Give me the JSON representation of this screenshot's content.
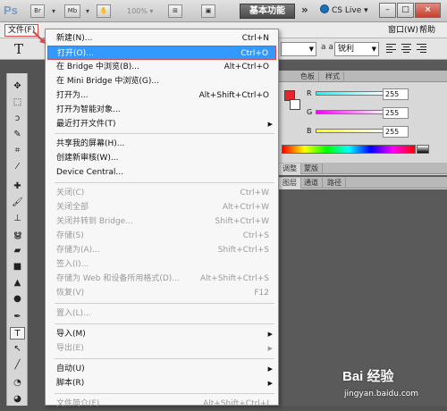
{
  "titlebar": {
    "logo": "Ps",
    "bridge": "Br",
    "minibridge": "Mb",
    "zoom": "100%",
    "workspace": "基本功能",
    "chevron": "»",
    "cslive": "CS Live",
    "minimize": "–",
    "restore": "□",
    "close": "×"
  },
  "menubar": {
    "items": [
      "文件(F)",
      "帮助(H)",
      "窗口(W)"
    ]
  },
  "options": {
    "tool_glyph": "T",
    "antialias_prefix": "a a",
    "antialias_value": "锐利"
  },
  "menu": {
    "items": [
      {
        "label": "新建(N)...",
        "shortcut": "Ctrl+N"
      },
      {
        "label": "打开(O)...",
        "shortcut": "Ctrl+O"
      },
      {
        "label": "在 Bridge 中浏览(B)...",
        "shortcut": "Alt+Ctrl+O"
      },
      {
        "label": "在 Mini Bridge 中浏览(G)...",
        "shortcut": ""
      },
      {
        "label": "打开为...",
        "shortcut": "Alt+Shift+Ctrl+O"
      },
      {
        "label": "打开为智能对象...",
        "shortcut": ""
      },
      {
        "label": "最近打开文件(T)",
        "shortcut": ""
      },
      {
        "label": "共享我的屏幕(H)...",
        "shortcut": ""
      },
      {
        "label": "创建新审核(W)...",
        "shortcut": ""
      },
      {
        "label": "Device Central...",
        "shortcut": ""
      },
      {
        "label": "关闭(C)",
        "shortcut": "Ctrl+W"
      },
      {
        "label": "关闭全部",
        "shortcut": "Alt+Ctrl+W"
      },
      {
        "label": "关闭并转到 Bridge...",
        "shortcut": "Shift+Ctrl+W"
      },
      {
        "label": "存储(S)",
        "shortcut": "Ctrl+S"
      },
      {
        "label": "存储为(A)...",
        "shortcut": "Shift+Ctrl+S"
      },
      {
        "label": "签入(I)...",
        "shortcut": ""
      },
      {
        "label": "存储为 Web 和设备所用格式(D)...",
        "shortcut": "Alt+Shift+Ctrl+S"
      },
      {
        "label": "恢复(V)",
        "shortcut": "F12"
      },
      {
        "label": "置入(L)...",
        "shortcut": ""
      },
      {
        "label": "导入(M)",
        "shortcut": ""
      },
      {
        "label": "导出(E)",
        "shortcut": ""
      },
      {
        "label": "自动(U)",
        "shortcut": ""
      },
      {
        "label": "脚本(R)",
        "shortcut": ""
      },
      {
        "label": "文件简介(F)...",
        "shortcut": "Alt+Shift+Ctrl+I"
      }
    ]
  },
  "panels": {
    "color_tabs": [
      "色板",
      "样式"
    ],
    "channels": [
      {
        "label": "R",
        "value": "255"
      },
      {
        "label": "G",
        "value": "255"
      },
      {
        "label": "B",
        "value": "255"
      }
    ],
    "adjust_tabs": [
      "调整",
      "蒙版"
    ],
    "layer_tabs": [
      "图层",
      "通道",
      "路径"
    ]
  },
  "watermark": {
    "logo": "Bai 经验",
    "url": "jingyan.baidu.com"
  },
  "colors": {
    "highlight": "#3399ff",
    "annotation_red": "#d64a4a",
    "foreground_swatch": "#e8262a"
  }
}
